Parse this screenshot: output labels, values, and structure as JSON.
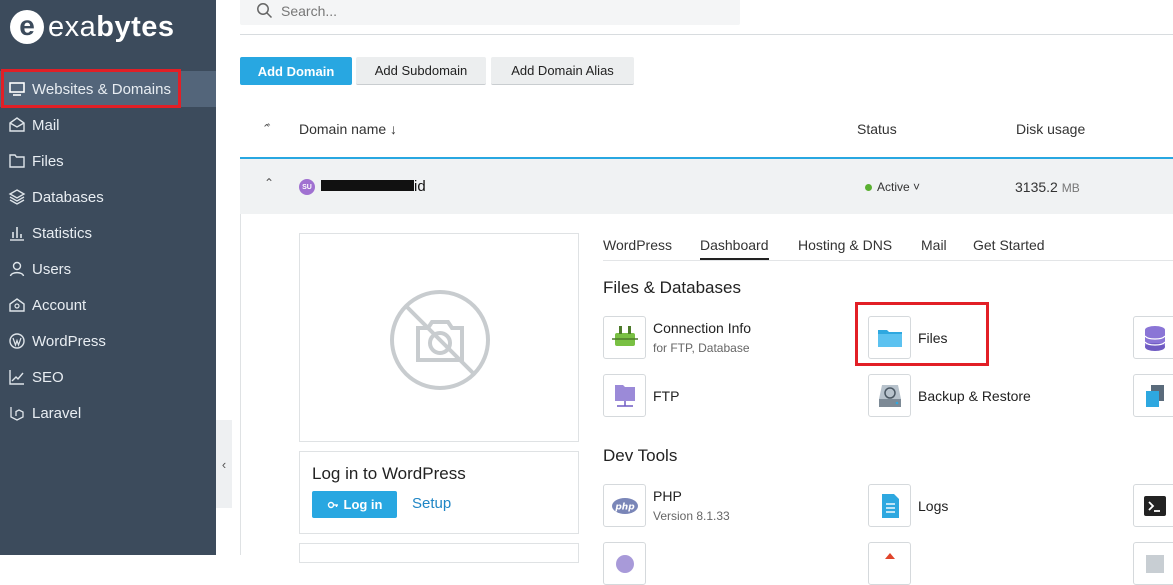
{
  "brand": {
    "logo_letter": "e",
    "name_light": "exa",
    "name_bold": "bytes"
  },
  "sidebar": {
    "items": [
      {
        "label": "Websites & Domains",
        "icon": "monitor-icon",
        "active": true
      },
      {
        "label": "Mail",
        "icon": "mail-icon"
      },
      {
        "label": "Files",
        "icon": "folder-icon"
      },
      {
        "label": "Databases",
        "icon": "layers-icon"
      },
      {
        "label": "Statistics",
        "icon": "bar-chart-icon"
      },
      {
        "label": "Users",
        "icon": "user-icon"
      },
      {
        "label": "Account",
        "icon": "account-icon"
      },
      {
        "label": "WordPress",
        "icon": "wordpress-icon"
      },
      {
        "label": "SEO",
        "icon": "seo-chart-icon"
      },
      {
        "label": "Laravel",
        "icon": "laravel-icon"
      }
    ],
    "collapse_glyph": "‹"
  },
  "search": {
    "placeholder": "Search..."
  },
  "actions": {
    "add_domain": "Add Domain",
    "add_subdomain": "Add Subdomain",
    "add_domain_alias": "Add Domain Alias"
  },
  "table": {
    "headers": {
      "domain_name": "Domain name ↓",
      "status": "Status",
      "disk_usage": "Disk usage"
    },
    "row": {
      "badge": "SU",
      "domain_suffix": "id",
      "status": "Active ˅",
      "disk_value": "3135.2",
      "disk_unit": "MB"
    }
  },
  "wordpress_box": {
    "title": "Log in to WordPress",
    "login_label": "Log in",
    "setup_label": "Setup"
  },
  "tabs": [
    "WordPress",
    "Dashboard",
    "Hosting & DNS",
    "Mail",
    "Get Started"
  ],
  "active_tab": "Dashboard",
  "sections": {
    "files_db": {
      "title": "Files & Databases",
      "connection": {
        "label": "Connection Info",
        "sub": "for FTP, Database"
      },
      "files": {
        "label": "Files"
      },
      "ftp": {
        "label": "FTP"
      },
      "backup": {
        "label": "Backup & Restore"
      }
    },
    "dev_tools": {
      "title": "Dev Tools",
      "php": {
        "label": "PHP",
        "sub": "Version 8.1.33"
      },
      "logs": {
        "label": "Logs"
      }
    }
  },
  "colors": {
    "sidebar": "#3c4b5c",
    "accent": "#28a7e1",
    "highlight": "#e21f26",
    "active_status": "#5ab031"
  }
}
